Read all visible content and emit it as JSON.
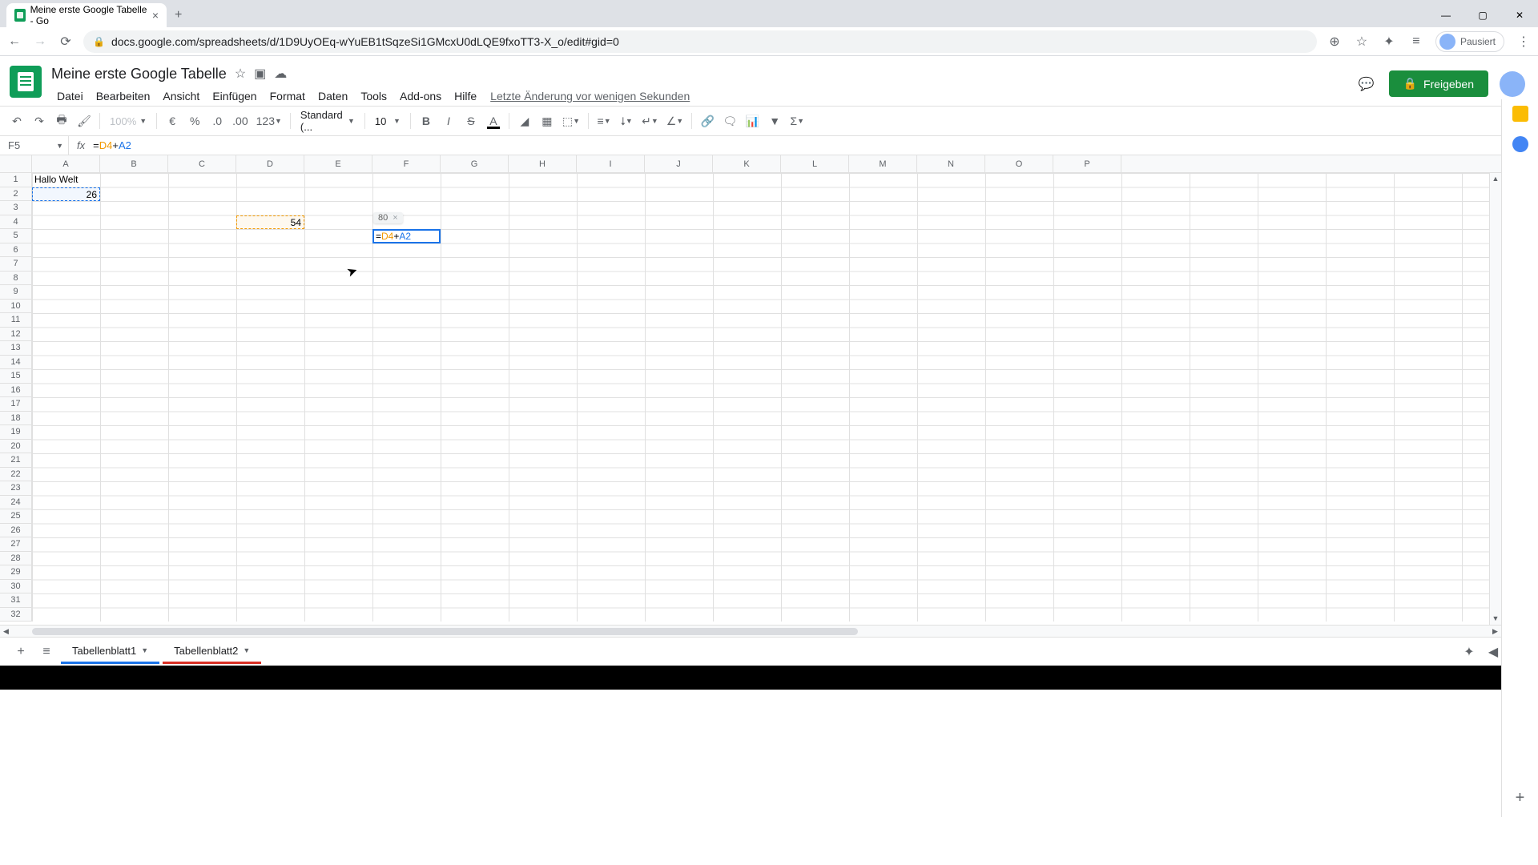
{
  "browser": {
    "tab_title": "Meine erste Google Tabelle - Go",
    "url": "docs.google.com/spreadsheets/d/1D9UyOEq-wYuEB1tSqzeSi1GMcxU0dLQE9fxoTT3-X_o/edit#gid=0",
    "profile_label": "Pausiert"
  },
  "doc": {
    "title": "Meine erste Google Tabelle",
    "last_edit": "Letzte Änderung vor wenigen Sekunden",
    "share": "Freigeben"
  },
  "menus": {
    "file": "Datei",
    "edit": "Bearbeiten",
    "view": "Ansicht",
    "insert": "Einfügen",
    "format": "Format",
    "data": "Daten",
    "tools": "Tools",
    "addons": "Add-ons",
    "help": "Hilfe"
  },
  "toolbar": {
    "zoom": "100%",
    "currency": "€",
    "percent": "%",
    "dec_less": ".0",
    "dec_more": ".00",
    "num_fmt": "123",
    "font": "Standard (...",
    "font_size": "10"
  },
  "formula_bar": {
    "cell_ref": "F5",
    "formula_eq": "=",
    "formula_ref1": "D4",
    "formula_plus": "+",
    "formula_ref2": "A2"
  },
  "columns": [
    "A",
    "B",
    "C",
    "D",
    "E",
    "F",
    "G",
    "H",
    "I",
    "J",
    "K",
    "L",
    "M",
    "N",
    "O",
    "P"
  ],
  "rows": [
    "1",
    "2",
    "3",
    "4",
    "5",
    "6",
    "7",
    "8",
    "9",
    "10",
    "11",
    "12",
    "13",
    "14",
    "15",
    "16",
    "17",
    "18",
    "19",
    "20",
    "21",
    "22",
    "23",
    "24",
    "25",
    "26",
    "27",
    "28",
    "29",
    "30",
    "31",
    "32"
  ],
  "cells": {
    "A1": "Hallo Welt",
    "A2": "26",
    "D4": "54",
    "F5_eq": "=",
    "F5_r1": "D4",
    "F5_plus": "+",
    "F5_r2": "A2"
  },
  "tooltip": {
    "result": "80",
    "close": "×"
  },
  "sheets": {
    "tab1": "Tabellenblatt1",
    "tab2": "Tabellenblatt2"
  }
}
